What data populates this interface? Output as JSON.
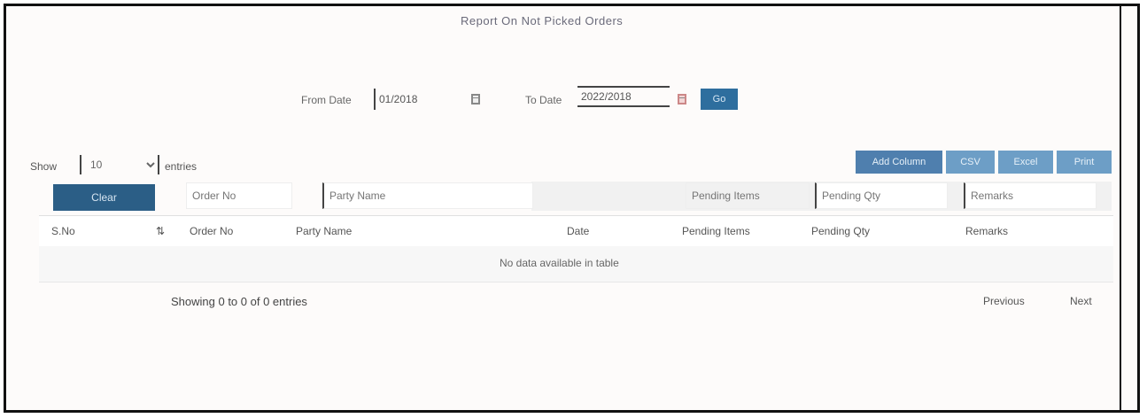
{
  "page": {
    "title": "Report On Not Picked Orders"
  },
  "filters": {
    "from_label": "From Date",
    "from_value": "01/2018",
    "to_label": "To Date",
    "to_value": "2022/2018",
    "go_label": "Go"
  },
  "length": {
    "show_label": "Show",
    "value": "10",
    "entries_label": "entries"
  },
  "toolbar": {
    "buttons": [
      "Add Column",
      "CSV",
      "Excel",
      "Print"
    ]
  },
  "column_filters": {
    "clear_label": "Clear",
    "placeholders": [
      "Order No",
      "Party Name",
      "Pending Items",
      "Pending Qty",
      "Remarks"
    ]
  },
  "table": {
    "columns": [
      "S.No",
      "Order No",
      "Party Name",
      "Date",
      "Pending Items",
      "Pending Qty",
      "Remarks"
    ],
    "empty_message": "No data available in table"
  },
  "footer": {
    "info": "Showing 0 to 0 of 0 entries",
    "previous": "Previous",
    "next": "Next"
  }
}
